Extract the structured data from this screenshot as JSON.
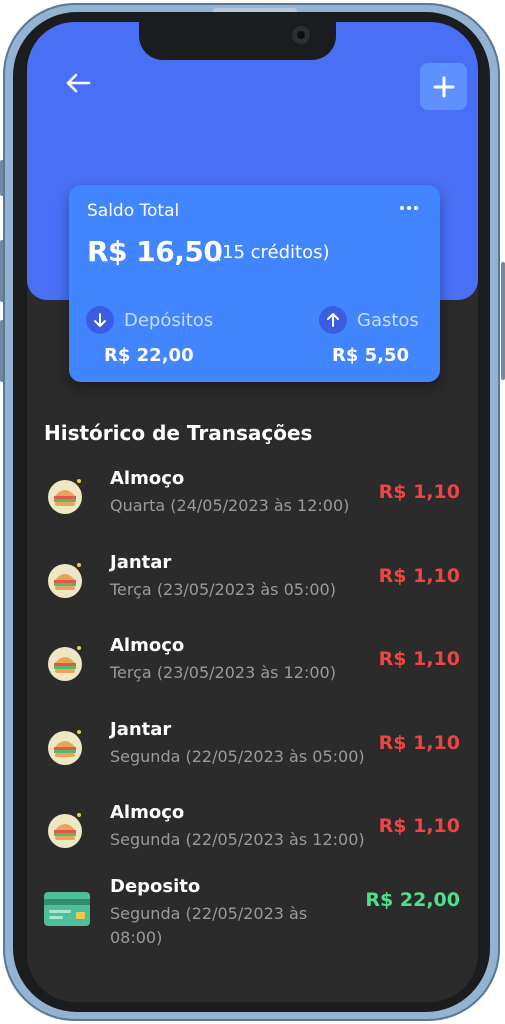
{
  "header": {
    "back_icon": "arrow-left-icon",
    "add_icon": "plus-icon"
  },
  "balance": {
    "title": "Saldo Total",
    "menu_icon": "more-horizontal-icon",
    "amount": "R$ 16,50",
    "credits": "(15 créditos)",
    "deposits": {
      "label": "Depósitos",
      "value": "R$ 22,00",
      "icon": "arrow-down-icon"
    },
    "expenses": {
      "label": "Gastos",
      "value": "R$ 5,50",
      "icon": "arrow-up-icon"
    }
  },
  "history": {
    "title": "Histórico de Transações",
    "transactions": [
      {
        "name": "Almoço",
        "date": "Quarta (24/05/2023 às 12:00)",
        "amount": "R$ 1,10",
        "icon": "burger-icon",
        "type": "expense"
      },
      {
        "name": "Jantar",
        "date": "Terça (23/05/2023 às 05:00)",
        "amount": "R$ 1,10",
        "icon": "burger-icon",
        "type": "expense"
      },
      {
        "name": "Almoço",
        "date": "Terça (23/05/2023 às 12:00)",
        "amount": "R$ 1,10",
        "icon": "burger-icon",
        "type": "expense"
      },
      {
        "name": "Jantar",
        "date": "Segunda (22/05/2023 às 05:00)",
        "amount": "R$ 1,10",
        "icon": "burger-icon",
        "type": "expense"
      },
      {
        "name": "Almoço",
        "date": "Segunda (22/05/2023 às 12:00)",
        "amount": "R$ 1,10",
        "icon": "burger-icon",
        "type": "expense"
      },
      {
        "name": "Deposito",
        "date": "Segunda (22/05/2023 às 08:00)",
        "amount": "R$ 22,00",
        "icon": "credit-card-icon",
        "type": "deposit"
      }
    ]
  },
  "colors": {
    "header_blue": "#4a6ff7",
    "card_blue": "#4186ff",
    "background": "#2b2b2c",
    "expense_red": "#ef4444",
    "deposit_green": "#4ee08f"
  }
}
